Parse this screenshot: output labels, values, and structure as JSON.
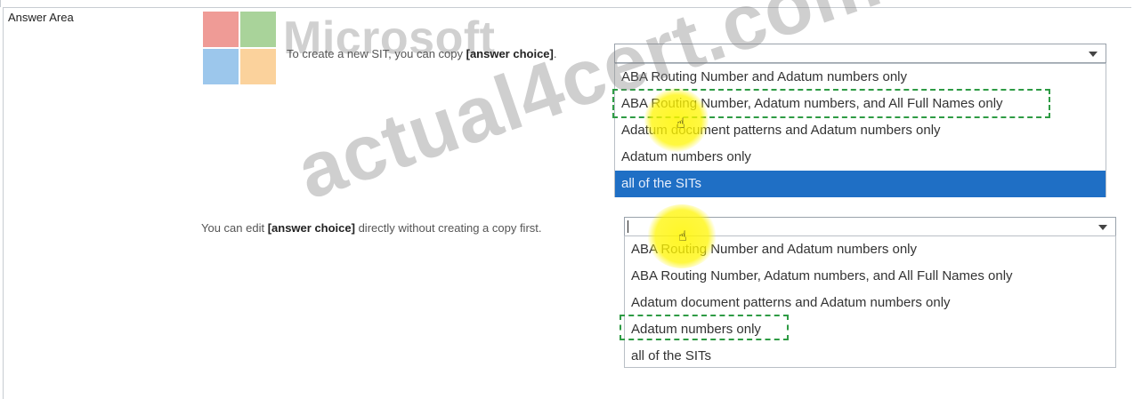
{
  "answer_area": {
    "label": "Answer Area"
  },
  "logo": {
    "word": "Microsoft"
  },
  "watermark": {
    "text": "actual4cert.com"
  },
  "questions": [
    {
      "text_before": "To create a new SIT, you can copy ",
      "choice_placeholder": "[answer choice]",
      "text_after": ".",
      "selected_value": "",
      "options": [
        "ABA Routing Number and Adatum numbers only",
        "ABA Routing Number, Adatum numbers, and All Full Names only",
        "Adatum document patterns and Adatum numbers only",
        "Adatum numbers only",
        "all of the SITs"
      ],
      "highlighted_option_index": 4,
      "marked_answer_index": 1
    },
    {
      "text_before": "You can edit ",
      "choice_placeholder": "[answer choice]",
      "text_after": " directly without creating a copy first.",
      "selected_value": "",
      "options": [
        "ABA Routing Number and Adatum numbers only",
        "ABA Routing Number, Adatum numbers, and All Full Names only",
        "Adatum document patterns and Adatum numbers only",
        "Adatum numbers only",
        "all of the SITs"
      ],
      "highlighted_option_index": -1,
      "marked_answer_index": 3
    }
  ],
  "colors": {
    "selection": "#1f6fc5",
    "answer_marker": "#2e9b44",
    "highlight": "#fff500"
  },
  "icons": [
    "microsoft-logo-icon",
    "dropdown-arrow-icon",
    "hand-cursor-icon"
  ]
}
